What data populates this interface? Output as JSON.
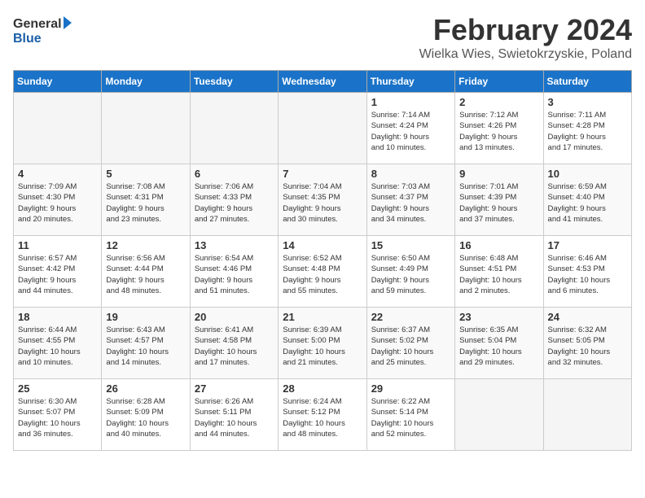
{
  "header": {
    "logo_line1": "General",
    "logo_line2": "Blue",
    "title": "February 2024",
    "subtitle": "Wielka Wies, Swietokrzyskie, Poland"
  },
  "columns": [
    "Sunday",
    "Monday",
    "Tuesday",
    "Wednesday",
    "Thursday",
    "Friday",
    "Saturday"
  ],
  "weeks": [
    {
      "days": [
        {
          "num": "",
          "info": "",
          "empty": true
        },
        {
          "num": "",
          "info": "",
          "empty": true
        },
        {
          "num": "",
          "info": "",
          "empty": true
        },
        {
          "num": "",
          "info": "",
          "empty": true
        },
        {
          "num": "1",
          "info": "Sunrise: 7:14 AM\nSunset: 4:24 PM\nDaylight: 9 hours\nand 10 minutes."
        },
        {
          "num": "2",
          "info": "Sunrise: 7:12 AM\nSunset: 4:26 PM\nDaylight: 9 hours\nand 13 minutes."
        },
        {
          "num": "3",
          "info": "Sunrise: 7:11 AM\nSunset: 4:28 PM\nDaylight: 9 hours\nand 17 minutes."
        }
      ]
    },
    {
      "days": [
        {
          "num": "4",
          "info": "Sunrise: 7:09 AM\nSunset: 4:30 PM\nDaylight: 9 hours\nand 20 minutes."
        },
        {
          "num": "5",
          "info": "Sunrise: 7:08 AM\nSunset: 4:31 PM\nDaylight: 9 hours\nand 23 minutes."
        },
        {
          "num": "6",
          "info": "Sunrise: 7:06 AM\nSunset: 4:33 PM\nDaylight: 9 hours\nand 27 minutes."
        },
        {
          "num": "7",
          "info": "Sunrise: 7:04 AM\nSunset: 4:35 PM\nDaylight: 9 hours\nand 30 minutes."
        },
        {
          "num": "8",
          "info": "Sunrise: 7:03 AM\nSunset: 4:37 PM\nDaylight: 9 hours\nand 34 minutes."
        },
        {
          "num": "9",
          "info": "Sunrise: 7:01 AM\nSunset: 4:39 PM\nDaylight: 9 hours\nand 37 minutes."
        },
        {
          "num": "10",
          "info": "Sunrise: 6:59 AM\nSunset: 4:40 PM\nDaylight: 9 hours\nand 41 minutes."
        }
      ]
    },
    {
      "days": [
        {
          "num": "11",
          "info": "Sunrise: 6:57 AM\nSunset: 4:42 PM\nDaylight: 9 hours\nand 44 minutes."
        },
        {
          "num": "12",
          "info": "Sunrise: 6:56 AM\nSunset: 4:44 PM\nDaylight: 9 hours\nand 48 minutes."
        },
        {
          "num": "13",
          "info": "Sunrise: 6:54 AM\nSunset: 4:46 PM\nDaylight: 9 hours\nand 51 minutes."
        },
        {
          "num": "14",
          "info": "Sunrise: 6:52 AM\nSunset: 4:48 PM\nDaylight: 9 hours\nand 55 minutes."
        },
        {
          "num": "15",
          "info": "Sunrise: 6:50 AM\nSunset: 4:49 PM\nDaylight: 9 hours\nand 59 minutes."
        },
        {
          "num": "16",
          "info": "Sunrise: 6:48 AM\nSunset: 4:51 PM\nDaylight: 10 hours\nand 2 minutes."
        },
        {
          "num": "17",
          "info": "Sunrise: 6:46 AM\nSunset: 4:53 PM\nDaylight: 10 hours\nand 6 minutes."
        }
      ]
    },
    {
      "days": [
        {
          "num": "18",
          "info": "Sunrise: 6:44 AM\nSunset: 4:55 PM\nDaylight: 10 hours\nand 10 minutes."
        },
        {
          "num": "19",
          "info": "Sunrise: 6:43 AM\nSunset: 4:57 PM\nDaylight: 10 hours\nand 14 minutes."
        },
        {
          "num": "20",
          "info": "Sunrise: 6:41 AM\nSunset: 4:58 PM\nDaylight: 10 hours\nand 17 minutes."
        },
        {
          "num": "21",
          "info": "Sunrise: 6:39 AM\nSunset: 5:00 PM\nDaylight: 10 hours\nand 21 minutes."
        },
        {
          "num": "22",
          "info": "Sunrise: 6:37 AM\nSunset: 5:02 PM\nDaylight: 10 hours\nand 25 minutes."
        },
        {
          "num": "23",
          "info": "Sunrise: 6:35 AM\nSunset: 5:04 PM\nDaylight: 10 hours\nand 29 minutes."
        },
        {
          "num": "24",
          "info": "Sunrise: 6:32 AM\nSunset: 5:05 PM\nDaylight: 10 hours\nand 32 minutes."
        }
      ]
    },
    {
      "days": [
        {
          "num": "25",
          "info": "Sunrise: 6:30 AM\nSunset: 5:07 PM\nDaylight: 10 hours\nand 36 minutes."
        },
        {
          "num": "26",
          "info": "Sunrise: 6:28 AM\nSunset: 5:09 PM\nDaylight: 10 hours\nand 40 minutes."
        },
        {
          "num": "27",
          "info": "Sunrise: 6:26 AM\nSunset: 5:11 PM\nDaylight: 10 hours\nand 44 minutes."
        },
        {
          "num": "28",
          "info": "Sunrise: 6:24 AM\nSunset: 5:12 PM\nDaylight: 10 hours\nand 48 minutes."
        },
        {
          "num": "29",
          "info": "Sunrise: 6:22 AM\nSunset: 5:14 PM\nDaylight: 10 hours\nand 52 minutes."
        },
        {
          "num": "",
          "info": "",
          "empty": true
        },
        {
          "num": "",
          "info": "",
          "empty": true
        }
      ]
    }
  ]
}
